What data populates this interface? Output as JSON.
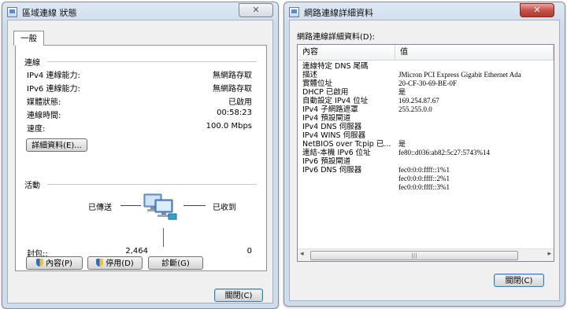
{
  "status_window": {
    "title": "區域連線 狀態",
    "close_glyph": "✕",
    "tab": "一般",
    "connection": {
      "section": "連線",
      "rows": [
        {
          "label": "IPv4 連線能力:",
          "value": "無網路存取"
        },
        {
          "label": "IPv6 連線能力:",
          "value": "無網路存取"
        },
        {
          "label": "媒體狀態:",
          "value": "已啟用"
        },
        {
          "label": "連線時間:",
          "value": "00:58:23"
        },
        {
          "label": "速度:",
          "value": "100.0 Mbps"
        }
      ],
      "details_button": "詳細資料(E)..."
    },
    "activity": {
      "section": "活動",
      "sent": "已傳送",
      "received": "已收到",
      "packets_label": "封包::",
      "sent_count": "2,464",
      "received_count": "0"
    },
    "buttons": {
      "properties": "內容(P)",
      "disable": "停用(D)",
      "diagnose": "診斷(G)"
    },
    "close_button": "關閉(C)"
  },
  "details_window": {
    "title": "網路連線詳細資料",
    "close_glyph": "✕",
    "heading": "網路連線詳細資料(D):",
    "columns": {
      "property": "內容",
      "value": "值"
    },
    "rows": [
      {
        "property": "連線特定 DNS 尾碼",
        "value": ""
      },
      {
        "property": "描述",
        "value": "JMicron PCI Express Gigabit Ethernet Ada"
      },
      {
        "property": "實體位址",
        "value": "20-CF-30-69-BE-0F"
      },
      {
        "property": "DHCP 已啟用",
        "value": "是"
      },
      {
        "property": "自動設定 IPv4 位址",
        "value": "169.254.87.67"
      },
      {
        "property": "IPv4 子網路遮罩",
        "value": "255.255.0.0"
      },
      {
        "property": "IPv4 預設閘道",
        "value": ""
      },
      {
        "property": "IPv4 DNS 伺服器",
        "value": ""
      },
      {
        "property": "IPv4 WINS 伺服器",
        "value": ""
      },
      {
        "property": "NetBIOS over Tcpip 已...",
        "value": "是"
      },
      {
        "property": "連結-本機 IPv6 位址",
        "value": "fe80::d036:ab82:5c27:5743%14"
      },
      {
        "property": "IPv6 預設閘道",
        "value": ""
      },
      {
        "property": "IPv6 DNS 伺服器",
        "value": "fec0:0:0:ffff::1%1"
      },
      {
        "property": "",
        "value": "fec0:0:0:ffff::2%1"
      },
      {
        "property": "",
        "value": "fec0:0:0:ffff::3%1"
      }
    ],
    "scroll_left": "◂",
    "scroll_right": "▸",
    "scroll_grip": "|||",
    "close_button": "關閉(C)"
  }
}
